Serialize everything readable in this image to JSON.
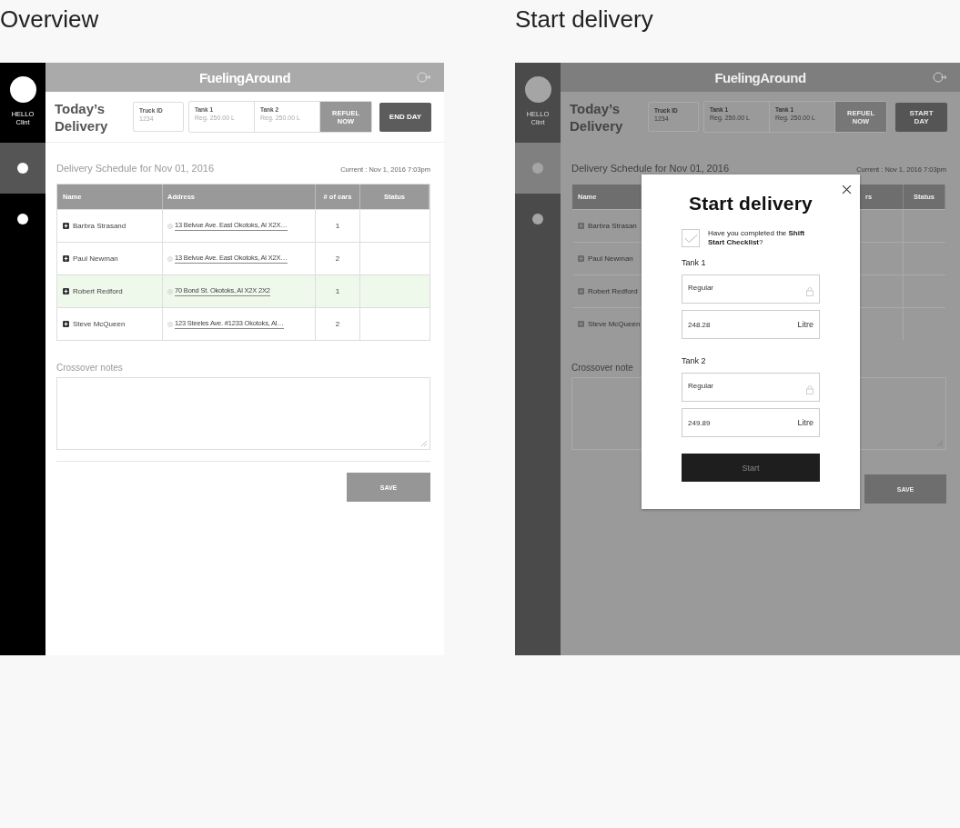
{
  "screens": [
    {
      "kind": "overview",
      "title": "Overview",
      "logo": "FuelingAround",
      "greeting": "HELLO",
      "user": "Clint",
      "nav": [
        {
          "selected": true
        },
        {
          "selected": false
        }
      ],
      "heading": "Today’s Delivery",
      "truck": {
        "label": "Truck ID",
        "value": "1234"
      },
      "tanks": [
        {
          "label": "Tank 1",
          "value": "Reg. 250.00 L"
        },
        {
          "label": "Tank 2",
          "value": "Reg. 250.00 L"
        }
      ],
      "refuel": {
        "label": "REFUEL NOW",
        "disabled": true
      },
      "day_button": "END DAY",
      "schedule_title": "Delivery Schedule for Nov 01, 2016",
      "current": "Current : Nov 1, 2016 7:03pm",
      "table": {
        "columns": [
          "Name",
          "Address",
          "# of cars",
          "Status"
        ],
        "rows": [
          {
            "name": "Barbra Strasand",
            "address": "13 Belvue Ave. East Okotoks, Al X2X…",
            "cars": "1",
            "selected": false
          },
          {
            "name": "Paul Newman",
            "address": "13 Belvue Ave. East Okotoks, Al X2X…",
            "cars": "2",
            "selected": false
          },
          {
            "name": "Robert Redford",
            "address": "70 Bond St. Okotoks, Al X2X 2X2",
            "cars": "1",
            "selected": true
          },
          {
            "name": "Steve McQueen",
            "address": "123 Steeles Ave. #1233 Okotoks, Al…",
            "cars": "2",
            "selected": false
          }
        ]
      },
      "notes_label": "Crossover notes",
      "save": {
        "label": "SAVE",
        "disabled": true
      }
    },
    {
      "kind": "dialog",
      "title": "Start delivery",
      "logo": "FuelingAround",
      "greeting": "HELLO",
      "user": "Clint",
      "nav": [
        {
          "selected": true
        },
        {
          "selected": false
        }
      ],
      "heading": "Today’s Delivery",
      "truck": {
        "label": "Truck ID",
        "value": "1234"
      },
      "tanks": [
        {
          "label": "Tank 1",
          "value": "Reg. 250.00 L"
        },
        {
          "label": "Tank 1",
          "value": "Reg. 250.00 L"
        }
      ],
      "refuel": {
        "label": "REFUEL NOW",
        "disabled": true
      },
      "day_button": "START DAY",
      "schedule_title": "Delivery Schedule for Nov 01, 2016",
      "current": "Current : Nov 1, 2016 7:03pm",
      "table": {
        "left_columns": [
          "Name"
        ],
        "right_columns": [
          "rs",
          "Status"
        ],
        "rows": [
          {
            "name": "Barbra Strasan"
          },
          {
            "name": "Paul Newman"
          },
          {
            "name": "Robert Redford"
          },
          {
            "name": "Steve McQueen"
          }
        ]
      },
      "notes_label": "Crossover note",
      "save": {
        "label": "SAVE",
        "disabled": true
      },
      "dialog": {
        "title": "Start delivery",
        "checked": true,
        "question": "Have you completed the **Shift Start Checklist**?",
        "tanks": [
          {
            "label": "Tank 1",
            "fuel": "Regular",
            "amount": "248.28",
            "unit": "Litre"
          },
          {
            "label": "Tank 2",
            "fuel": "Regular",
            "amount": "249.89",
            "unit": "Litre"
          }
        ],
        "button": "Start"
      }
    }
  ]
}
